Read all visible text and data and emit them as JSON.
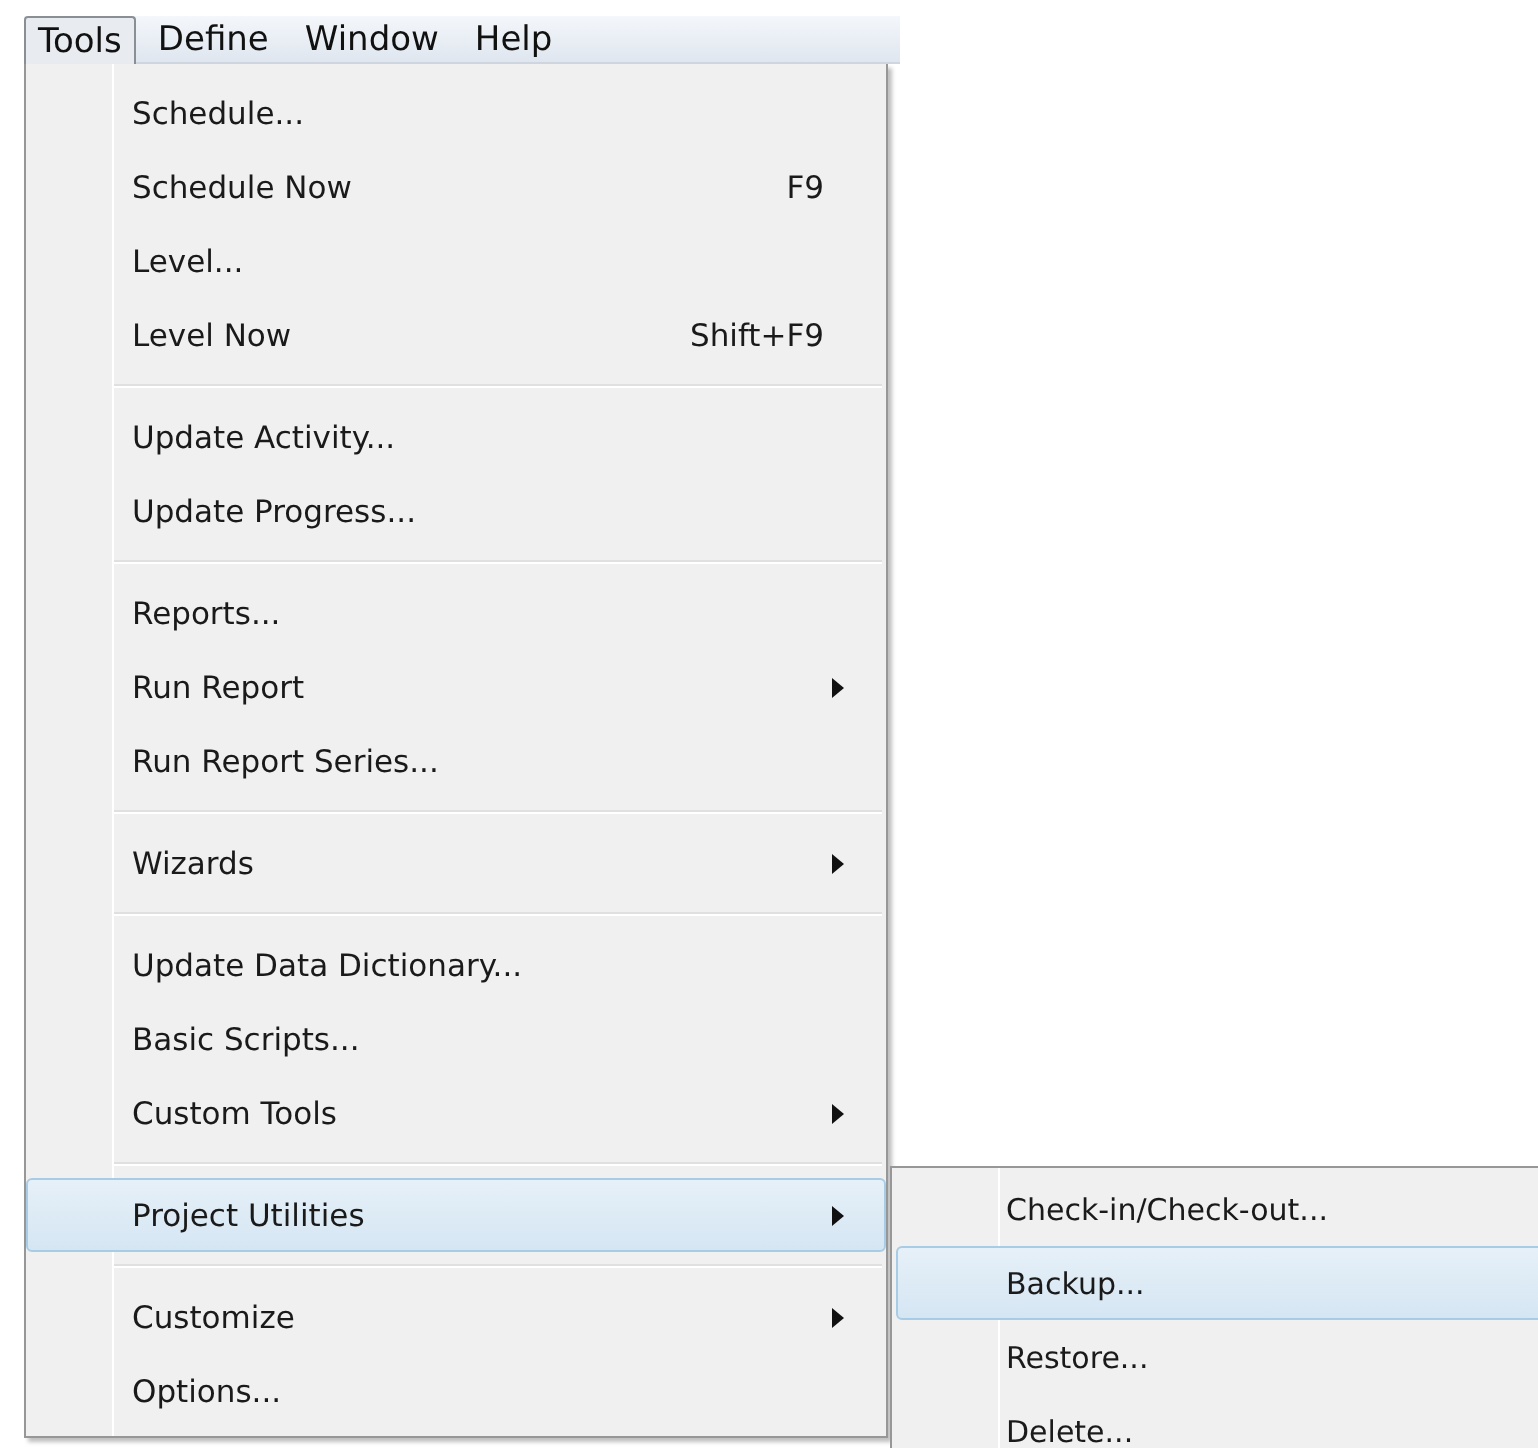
{
  "menu_bar": [
    {
      "label": "Tools",
      "selected": true
    },
    {
      "label": "Define",
      "selected": false
    },
    {
      "label": "Window",
      "selected": false
    },
    {
      "label": "Help",
      "selected": false
    }
  ],
  "menu": {
    "groups": [
      {
        "items": [
          {
            "label": "Schedule...",
            "has_submenu": false,
            "selected": false
          },
          {
            "label": "Schedule Now",
            "shortcut": "F9",
            "has_submenu": false,
            "selected": false
          },
          {
            "label": "Level...",
            "has_submenu": false,
            "selected": false
          },
          {
            "label": "Level Now",
            "shortcut": "Shift+F9",
            "has_submenu": false,
            "selected": false
          }
        ]
      },
      {
        "items": [
          {
            "label": "Update Activity...",
            "has_submenu": false,
            "selected": false
          },
          {
            "label": "Update Progress...",
            "has_submenu": false,
            "selected": false
          }
        ]
      },
      {
        "items": [
          {
            "label": "Reports...",
            "has_submenu": false,
            "selected": false
          },
          {
            "label": "Run Report",
            "has_submenu": true,
            "selected": false
          },
          {
            "label": "Run Report Series...",
            "has_submenu": false,
            "selected": false
          }
        ]
      },
      {
        "items": [
          {
            "label": "Wizards",
            "has_submenu": true,
            "selected": false
          }
        ]
      },
      {
        "items": [
          {
            "label": "Update Data Dictionary...",
            "has_submenu": false,
            "selected": false
          },
          {
            "label": "Basic Scripts...",
            "has_submenu": false,
            "selected": false
          },
          {
            "label": "Custom Tools",
            "has_submenu": true,
            "selected": false
          }
        ]
      },
      {
        "items": [
          {
            "label": "Project Utilities",
            "has_submenu": true,
            "selected": true
          }
        ]
      },
      {
        "items": [
          {
            "label": "Customize",
            "has_submenu": true,
            "selected": false
          },
          {
            "label": "Options...",
            "has_submenu": false,
            "selected": false
          }
        ]
      }
    ]
  },
  "submenu": {
    "items": [
      {
        "label": "Check-in/Check-out...",
        "selected": false
      },
      {
        "label": "Backup...",
        "selected": true
      },
      {
        "label": "Restore...",
        "selected": false
      },
      {
        "label": "Delete...",
        "selected": false
      }
    ]
  }
}
